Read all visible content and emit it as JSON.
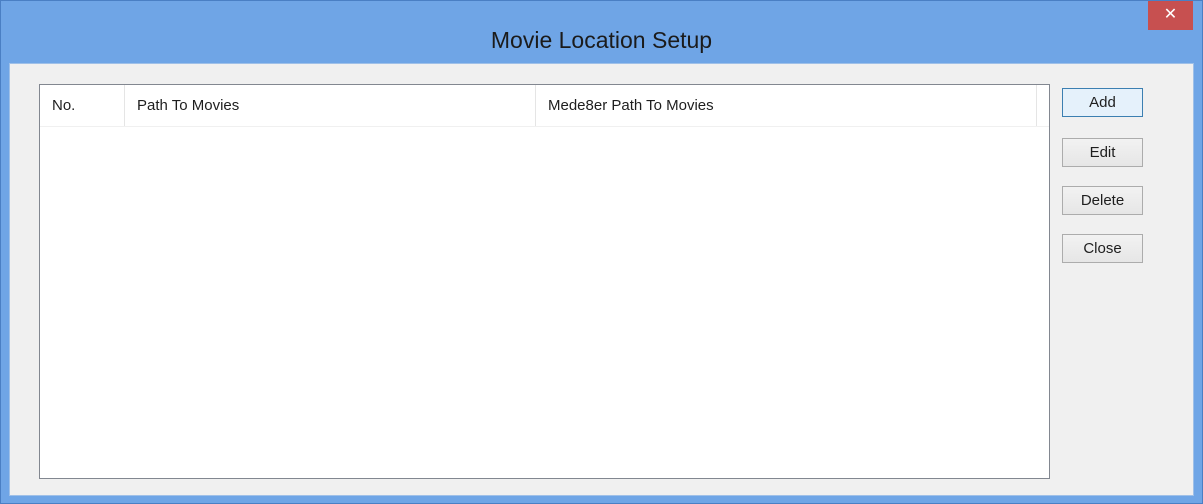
{
  "window": {
    "title": "Movie Location Setup",
    "close_glyph": "✕"
  },
  "list": {
    "columns": [
      "No.",
      "Path To Movies",
      "Mede8er Path To Movies"
    ],
    "rows": []
  },
  "buttons": {
    "add": "Add",
    "edit": "Edit",
    "delete": "Delete",
    "close": "Close"
  },
  "colors": {
    "titlebar": "#6fa5e6",
    "close_button": "#c75050",
    "client_background": "#f0f0f0"
  }
}
